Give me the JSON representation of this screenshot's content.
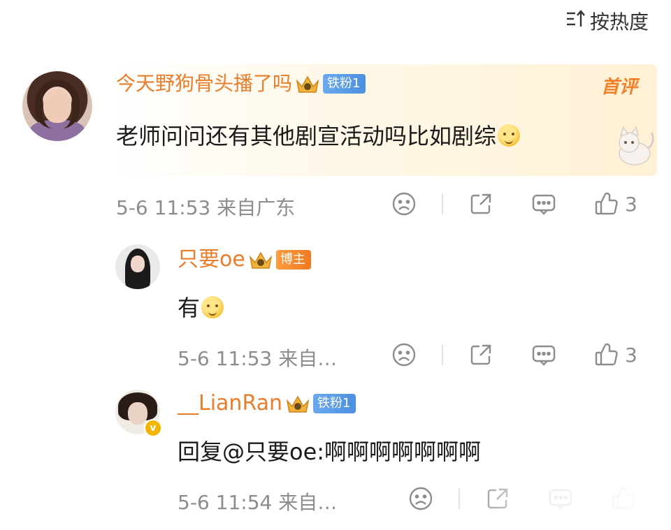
{
  "sort": {
    "label": "按热度"
  },
  "comments": [
    {
      "user": "今天野狗骨头播了吗",
      "badge": "铁粉1",
      "tag": "首评",
      "text": "老师问问还有其他剧宣活动吗比如剧综",
      "time": "5-6 11:53",
      "location": "来自广东",
      "likes": "3"
    },
    {
      "user": "只要oe",
      "badge": "博主",
      "text": "有",
      "time": "5-6 11:53",
      "location": "来自…",
      "likes": "3"
    },
    {
      "user": "__LianRan",
      "badge": "铁粉1",
      "verified": "v",
      "text": "回复@只要oe:啊啊啊啊啊啊啊",
      "time": "5-6 11:54",
      "location": "来自…",
      "likes": ""
    }
  ],
  "colors": {
    "name": "#e87d2b",
    "fan_badge": "#4b8fe0",
    "blogger_badge": "#f07a1f",
    "meta": "#8c8c8c"
  },
  "icons": [
    "sort-icon",
    "crown-icon",
    "emoji-icon",
    "sad-face-icon",
    "share-icon",
    "comment-icon",
    "like-icon"
  ]
}
